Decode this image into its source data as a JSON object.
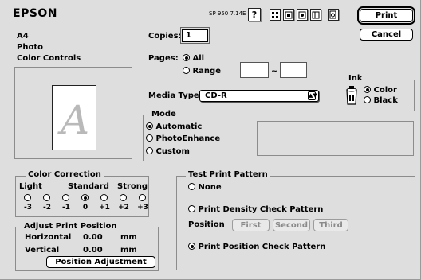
{
  "header": {
    "brand": "EPSON",
    "model_version": "SP 950 7.14E",
    "help_label": "?",
    "print_label": "Print",
    "cancel_label": "Cancel"
  },
  "summary": {
    "paper": "A4",
    "mode": "Photo",
    "color": "Color Controls",
    "preview_letter": "A"
  },
  "copies": {
    "label": "Copies:",
    "value": "1"
  },
  "pages": {
    "label": "Pages:",
    "all_label": "All",
    "range_label": "Range",
    "separator": "~",
    "from": "",
    "to": ""
  },
  "media": {
    "label": "Media Type:",
    "value": "CD-R"
  },
  "ink": {
    "title": "Ink",
    "color_label": "Color",
    "black_label": "Black",
    "selected": "Color"
  },
  "mode_group": {
    "title": "Mode",
    "options": [
      "Automatic",
      "PhotoEnhance",
      "Custom"
    ],
    "selected": "Automatic"
  },
  "color_correction": {
    "title": "Color Correction",
    "light_label": "Light",
    "standard_label": "Standard",
    "strong_label": "Strong",
    "steps": [
      "-3",
      "-2",
      "-1",
      "0",
      "+1",
      "+2",
      "+3"
    ],
    "selected": "0"
  },
  "adjust": {
    "title": "Adjust Print Position",
    "horizontal_label": "Horizontal",
    "horizontal_value": "0.00",
    "vertical_label": "Vertical",
    "vertical_value": "0.00",
    "unit": "mm",
    "button_label": "Position Adjustment"
  },
  "test_pattern": {
    "title": "Test Print Pattern",
    "none_label": "None",
    "density_label": "Print Density Check Pattern",
    "position_label": "Position",
    "first_label": "First",
    "second_label": "Second",
    "third_label": "Third",
    "position_check_label": "Print Position Check Pattern",
    "selected": "Print Position Check Pattern"
  },
  "colors": {
    "window_bg": "#dedede",
    "frame": "#8c8c8c"
  }
}
